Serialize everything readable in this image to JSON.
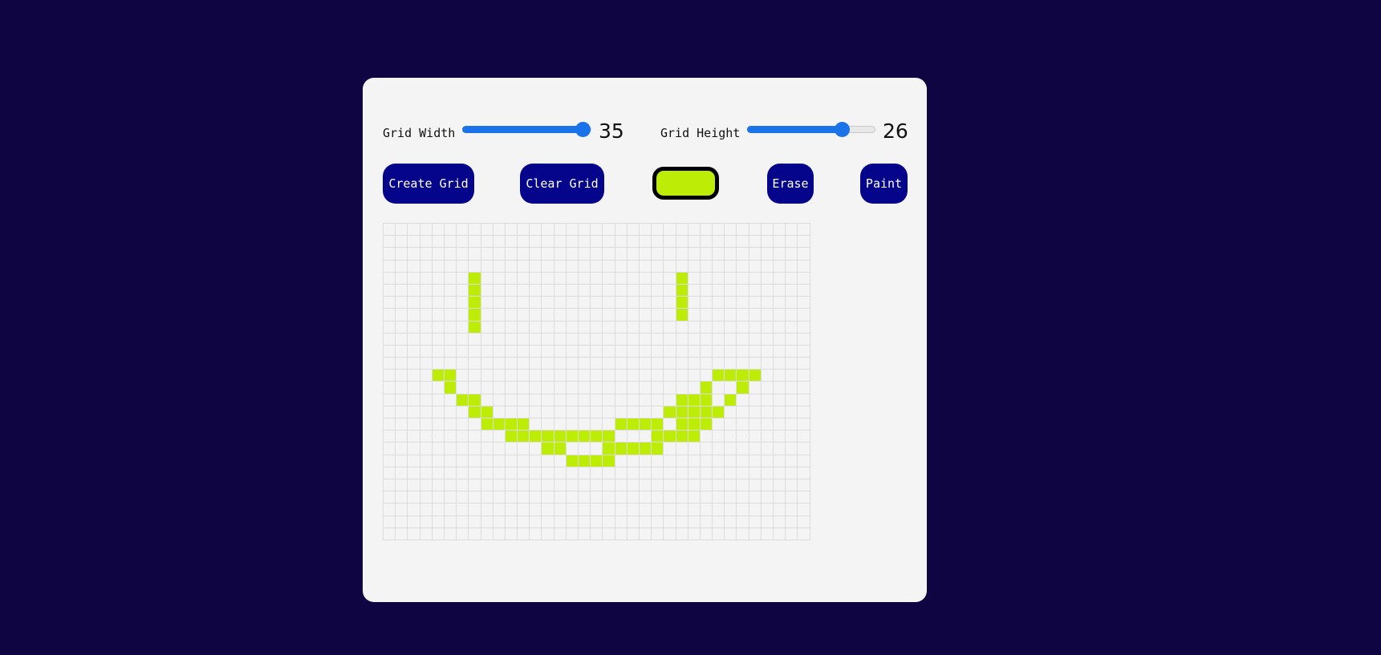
{
  "controls": {
    "grid_width": {
      "label": "Grid Width",
      "value": "35",
      "fraction": 1.0
    },
    "grid_height": {
      "label": "Grid Height",
      "value": "26",
      "fraction": 0.74
    }
  },
  "buttons": {
    "create": "Create Grid",
    "clear": "Clear Grid",
    "erase": "Erase",
    "paint": "Paint"
  },
  "colors": {
    "page_background": "#0f0542",
    "panel_background": "#f4f4f4",
    "button_background": "#05058c",
    "slider_accent": "#1a73e8",
    "paint_color": "#bdec06",
    "cell_border": "#dcdcdc"
  },
  "grid": {
    "columns": 35,
    "rows": 26,
    "painted": [
      [
        4,
        7
      ],
      [
        4,
        24
      ],
      [
        5,
        7
      ],
      [
        5,
        24
      ],
      [
        6,
        7
      ],
      [
        6,
        24
      ],
      [
        7,
        7
      ],
      [
        7,
        24
      ],
      [
        8,
        7
      ],
      [
        12,
        4
      ],
      [
        12,
        5
      ],
      [
        12,
        27
      ],
      [
        12,
        28
      ],
      [
        12,
        29
      ],
      [
        12,
        30
      ],
      [
        13,
        5
      ],
      [
        13,
        26
      ],
      [
        13,
        29
      ],
      [
        14,
        6
      ],
      [
        14,
        7
      ],
      [
        14,
        24
      ],
      [
        14,
        25
      ],
      [
        14,
        26
      ],
      [
        14,
        28
      ],
      [
        15,
        7
      ],
      [
        15,
        8
      ],
      [
        15,
        23
      ],
      [
        15,
        24
      ],
      [
        15,
        25
      ],
      [
        15,
        26
      ],
      [
        15,
        27
      ],
      [
        16,
        8
      ],
      [
        16,
        9
      ],
      [
        16,
        10
      ],
      [
        16,
        11
      ],
      [
        16,
        19
      ],
      [
        16,
        20
      ],
      [
        16,
        21
      ],
      [
        16,
        22
      ],
      [
        16,
        24
      ],
      [
        16,
        25
      ],
      [
        16,
        26
      ],
      [
        17,
        10
      ],
      [
        17,
        11
      ],
      [
        17,
        12
      ],
      [
        17,
        13
      ],
      [
        17,
        14
      ],
      [
        17,
        15
      ],
      [
        17,
        16
      ],
      [
        17,
        17
      ],
      [
        17,
        18
      ],
      [
        17,
        22
      ],
      [
        17,
        23
      ],
      [
        17,
        24
      ],
      [
        17,
        25
      ],
      [
        18,
        13
      ],
      [
        18,
        14
      ],
      [
        18,
        18
      ],
      [
        18,
        19
      ],
      [
        18,
        20
      ],
      [
        18,
        21
      ],
      [
        18,
        22
      ],
      [
        19,
        15
      ],
      [
        19,
        16
      ],
      [
        19,
        17
      ],
      [
        19,
        18
      ]
    ]
  }
}
